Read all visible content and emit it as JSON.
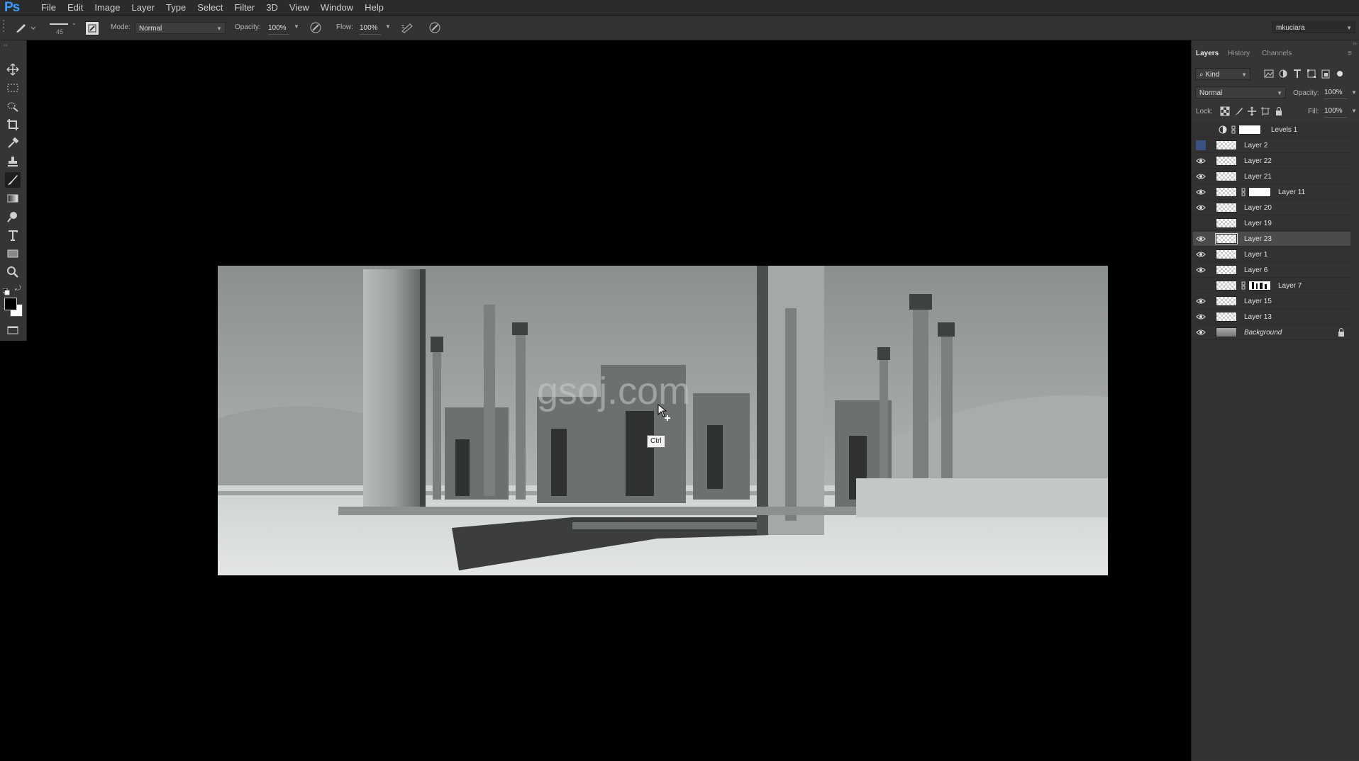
{
  "app": {
    "logo": "Ps"
  },
  "menu": [
    "File",
    "Edit",
    "Image",
    "Layer",
    "Type",
    "Select",
    "Filter",
    "3D",
    "View",
    "Window",
    "Help"
  ],
  "options": {
    "brush_size": "45",
    "mode_label": "Mode:",
    "mode_value": "Normal",
    "opacity_label": "Opacity:",
    "opacity_value": "100%",
    "flow_label": "Flow:",
    "flow_value": "100%",
    "workspace": "mkuciara"
  },
  "canvas": {
    "tooltip": "Ctrl",
    "watermark": "gsoj.com"
  },
  "panel": {
    "tabs": [
      "Layers",
      "History",
      "Channels"
    ],
    "filter_kind": "Kind",
    "blend_mode": "Normal",
    "opacity_label": "Opacity:",
    "opacity_value": "100%",
    "lock_label": "Lock:",
    "fill_label": "Fill:",
    "fill_value": "100%"
  },
  "layers": [
    {
      "name": "Levels 1",
      "visible": false,
      "type": "adjustment"
    },
    {
      "name": "Layer 2",
      "visible": false,
      "type": "pixel",
      "eye_highlight": true
    },
    {
      "name": "Layer 22",
      "visible": true,
      "type": "pixel"
    },
    {
      "name": "Layer 21",
      "visible": true,
      "type": "pixel"
    },
    {
      "name": "Layer 11",
      "visible": true,
      "type": "masked"
    },
    {
      "name": "Layer 20",
      "visible": true,
      "type": "pixel"
    },
    {
      "name": "Layer 19",
      "visible": false,
      "type": "pixel"
    },
    {
      "name": "Layer 23",
      "visible": true,
      "type": "pixel",
      "selected": true
    },
    {
      "name": "Layer 1",
      "visible": true,
      "type": "pixel"
    },
    {
      "name": "Layer 6",
      "visible": true,
      "type": "pixel"
    },
    {
      "name": "Layer 7",
      "visible": false,
      "type": "masked"
    },
    {
      "name": "Layer 15",
      "visible": true,
      "type": "pixel"
    },
    {
      "name": "Layer 13",
      "visible": true,
      "type": "pixel"
    },
    {
      "name": "Background",
      "visible": true,
      "type": "background",
      "locked": true
    }
  ]
}
